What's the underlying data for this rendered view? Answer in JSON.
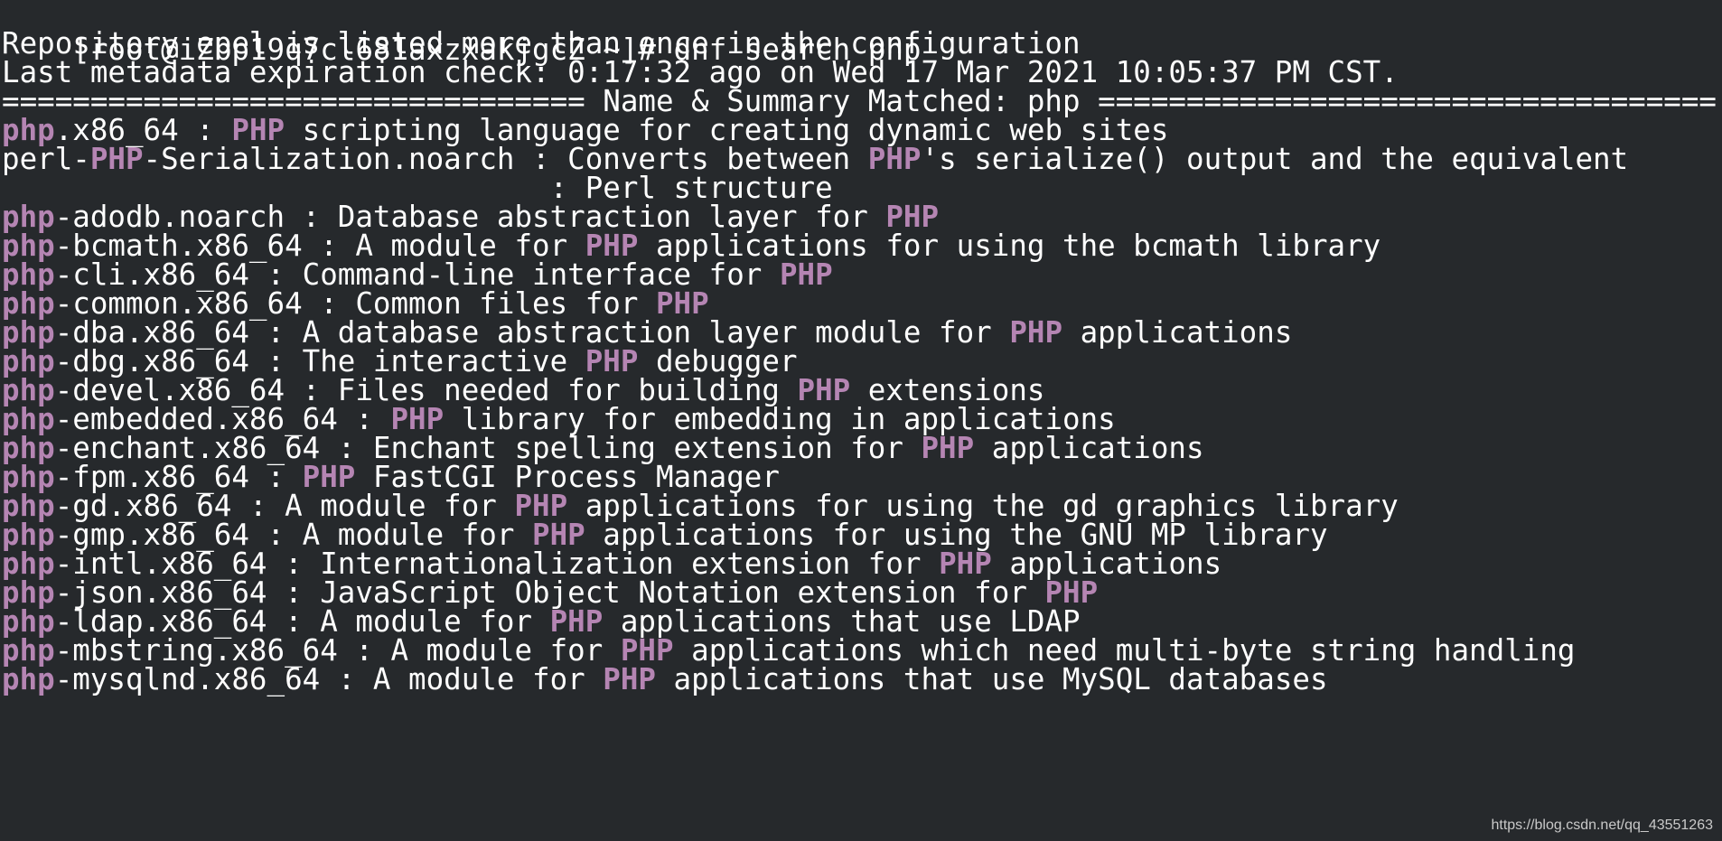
{
  "terminal": {
    "prompt": "[root@iZbp19q7cl681axzxakjgcZ ~]# ",
    "command": "dnf search php",
    "notice": "Repository epel is listed more than once in the configuration",
    "metadata": "Last metadata expiration check: 0:17:32 ago on Wed 17 Mar 2021 10:05:37 PM CST.",
    "separator": "================================= Name & Summary Matched: php ===================================",
    "highlight_color": "#b585b3",
    "results": [
      {
        "name": [
          {
            "t": "php",
            "hl": true
          },
          {
            "t": ".x86_64",
            "hl": false
          }
        ],
        "sep": " : ",
        "summary": [
          {
            "t": "PHP",
            "hl": true
          },
          {
            "t": " scripting language for creating dynamic web sites",
            "hl": false
          }
        ]
      },
      {
        "name": [
          {
            "t": "perl-",
            "hl": false
          },
          {
            "t": "PHP",
            "hl": true
          },
          {
            "t": "-Serialization.noarch",
            "hl": false
          }
        ],
        "sep": " : ",
        "summary": [
          {
            "t": "Converts between ",
            "hl": false
          },
          {
            "t": "PHP",
            "hl": true
          },
          {
            "t": "'s serialize() output and the equivalent",
            "hl": false
          }
        ]
      },
      {
        "continuation": true,
        "indent": "                              ",
        "sep": " : ",
        "summary": [
          {
            "t": "Perl structure",
            "hl": false
          }
        ]
      },
      {
        "name": [
          {
            "t": "php",
            "hl": true
          },
          {
            "t": "-adodb.noarch",
            "hl": false
          }
        ],
        "sep": " : ",
        "summary": [
          {
            "t": "Database abstraction layer for ",
            "hl": false
          },
          {
            "t": "PHP",
            "hl": true
          }
        ]
      },
      {
        "name": [
          {
            "t": "php",
            "hl": true
          },
          {
            "t": "-bcmath.x86_64",
            "hl": false
          }
        ],
        "sep": " : ",
        "summary": [
          {
            "t": "A module for ",
            "hl": false
          },
          {
            "t": "PHP",
            "hl": true
          },
          {
            "t": " applications for using the bcmath library",
            "hl": false
          }
        ]
      },
      {
        "name": [
          {
            "t": "php",
            "hl": true
          },
          {
            "t": "-cli.x86_64",
            "hl": false
          }
        ],
        "sep": " : ",
        "summary": [
          {
            "t": "Command-line interface for ",
            "hl": false
          },
          {
            "t": "PHP",
            "hl": true
          }
        ]
      },
      {
        "name": [
          {
            "t": "php",
            "hl": true
          },
          {
            "t": "-common.x86_64",
            "hl": false
          }
        ],
        "sep": " : ",
        "summary": [
          {
            "t": "Common files for ",
            "hl": false
          },
          {
            "t": "PHP",
            "hl": true
          }
        ]
      },
      {
        "name": [
          {
            "t": "php",
            "hl": true
          },
          {
            "t": "-dba.x86_64",
            "hl": false
          }
        ],
        "sep": " : ",
        "summary": [
          {
            "t": "A database abstraction layer module for ",
            "hl": false
          },
          {
            "t": "PHP",
            "hl": true
          },
          {
            "t": " applications",
            "hl": false
          }
        ]
      },
      {
        "name": [
          {
            "t": "php",
            "hl": true
          },
          {
            "t": "-dbg.x86_64",
            "hl": false
          }
        ],
        "sep": " : ",
        "summary": [
          {
            "t": "The interactive ",
            "hl": false
          },
          {
            "t": "PHP",
            "hl": true
          },
          {
            "t": " debugger",
            "hl": false
          }
        ]
      },
      {
        "name": [
          {
            "t": "php",
            "hl": true
          },
          {
            "t": "-devel.x86_64",
            "hl": false
          }
        ],
        "sep": " : ",
        "summary": [
          {
            "t": "Files needed for building ",
            "hl": false
          },
          {
            "t": "PHP",
            "hl": true
          },
          {
            "t": " extensions",
            "hl": false
          }
        ]
      },
      {
        "name": [
          {
            "t": "php",
            "hl": true
          },
          {
            "t": "-embedded.x86_64",
            "hl": false
          }
        ],
        "sep": " : ",
        "summary": [
          {
            "t": "PHP",
            "hl": true
          },
          {
            "t": " library for embedding in applications",
            "hl": false
          }
        ]
      },
      {
        "name": [
          {
            "t": "php",
            "hl": true
          },
          {
            "t": "-enchant.x86_64",
            "hl": false
          }
        ],
        "sep": " : ",
        "summary": [
          {
            "t": "Enchant spelling extension for ",
            "hl": false
          },
          {
            "t": "PHP",
            "hl": true
          },
          {
            "t": " applications",
            "hl": false
          }
        ]
      },
      {
        "name": [
          {
            "t": "php",
            "hl": true
          },
          {
            "t": "-fpm.x86_64",
            "hl": false
          }
        ],
        "sep": " : ",
        "summary": [
          {
            "t": "PHP",
            "hl": true
          },
          {
            "t": " FastCGI Process Manager",
            "hl": false
          }
        ]
      },
      {
        "name": [
          {
            "t": "php",
            "hl": true
          },
          {
            "t": "-gd.x86_64",
            "hl": false
          }
        ],
        "sep": " : ",
        "summary": [
          {
            "t": "A module for ",
            "hl": false
          },
          {
            "t": "PHP",
            "hl": true
          },
          {
            "t": " applications for using the gd graphics library",
            "hl": false
          }
        ]
      },
      {
        "name": [
          {
            "t": "php",
            "hl": true
          },
          {
            "t": "-gmp.x86_64",
            "hl": false
          }
        ],
        "sep": " : ",
        "summary": [
          {
            "t": "A module for ",
            "hl": false
          },
          {
            "t": "PHP",
            "hl": true
          },
          {
            "t": " applications for using the GNU MP library",
            "hl": false
          }
        ]
      },
      {
        "name": [
          {
            "t": "php",
            "hl": true
          },
          {
            "t": "-intl.x86_64",
            "hl": false
          }
        ],
        "sep": " : ",
        "summary": [
          {
            "t": "Internationalization extension for ",
            "hl": false
          },
          {
            "t": "PHP",
            "hl": true
          },
          {
            "t": " applications",
            "hl": false
          }
        ]
      },
      {
        "name": [
          {
            "t": "php",
            "hl": true
          },
          {
            "t": "-json.x86_64",
            "hl": false
          }
        ],
        "sep": " : ",
        "summary": [
          {
            "t": "JavaScript Object Notation extension for ",
            "hl": false
          },
          {
            "t": "PHP",
            "hl": true
          }
        ]
      },
      {
        "name": [
          {
            "t": "php",
            "hl": true
          },
          {
            "t": "-ldap.x86_64",
            "hl": false
          }
        ],
        "sep": " : ",
        "summary": [
          {
            "t": "A module for ",
            "hl": false
          },
          {
            "t": "PHP",
            "hl": true
          },
          {
            "t": " applications that use LDAP",
            "hl": false
          }
        ]
      },
      {
        "name": [
          {
            "t": "php",
            "hl": true
          },
          {
            "t": "-mbstring.x86_64",
            "hl": false
          }
        ],
        "sep": " : ",
        "summary": [
          {
            "t": "A module for ",
            "hl": false
          },
          {
            "t": "PHP",
            "hl": true
          },
          {
            "t": " applications which need multi-byte string handling",
            "hl": false
          }
        ]
      },
      {
        "name": [
          {
            "t": "php",
            "hl": true
          },
          {
            "t": "-mysqlnd.x86_64",
            "hl": false
          }
        ],
        "sep": " : ",
        "summary": [
          {
            "t": "A module for ",
            "hl": false
          },
          {
            "t": "PHP",
            "hl": true
          },
          {
            "t": " applications that use MySQL databases",
            "hl": false
          }
        ]
      }
    ]
  },
  "watermark": "https://blog.csdn.net/qq_43551263"
}
